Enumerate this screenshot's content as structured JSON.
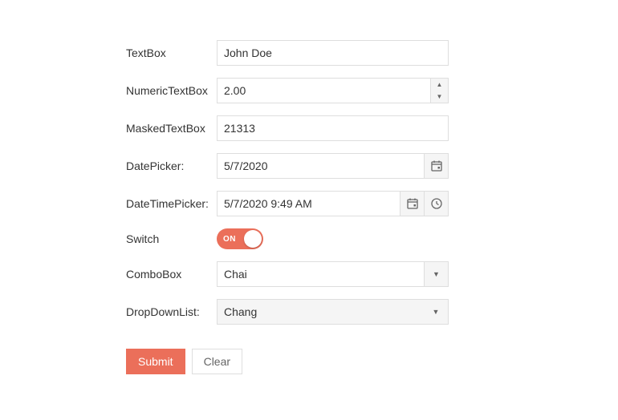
{
  "fields": {
    "textbox": {
      "label": "TextBox",
      "value": "John Doe"
    },
    "numeric": {
      "label": "NumericTextBox",
      "value": "2.00"
    },
    "masked": {
      "label": "MaskedTextBox",
      "value": "21313"
    },
    "datepicker": {
      "label": "DatePicker:",
      "value": "5/7/2020"
    },
    "datetimepicker": {
      "label": "DateTimePicker:",
      "value": "5/7/2020 9:49 AM"
    },
    "switch": {
      "label": "Switch",
      "state": "ON",
      "on": true
    },
    "combobox": {
      "label": "ComboBox",
      "value": "Chai"
    },
    "dropdownlist": {
      "label": "DropDownList:",
      "value": "Chang"
    }
  },
  "buttons": {
    "submit": "Submit",
    "clear": "Clear"
  },
  "colors": {
    "accent": "#eb6f5a",
    "border": "#dedede",
    "fill": "#f5f5f5"
  }
}
